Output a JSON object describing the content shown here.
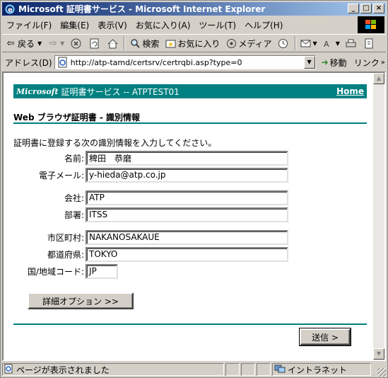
{
  "window": {
    "title": "Microsoft 証明書サービス - Microsoft Internet Explorer"
  },
  "menu": {
    "items": [
      "ファイル(F)",
      "編集(E)",
      "表示(V)",
      "お気に入り(A)",
      "ツール(T)",
      "ヘルプ(H)"
    ]
  },
  "toolbar": {
    "back_label": "戻る",
    "search_label": "検索",
    "favorites_label": "お気に入り",
    "media_label": "メディア"
  },
  "address": {
    "label": "アドレス(D)",
    "url": "http://atp-tamd/certsrv/certrqbi.asp?type=0",
    "go_label": "移動",
    "links_label": "リンク"
  },
  "page": {
    "brand": "Microsoft",
    "service_title": "証明書サービス  --  ATPTEST01",
    "home_link": "Home",
    "heading": "Web ブラウザ証明書 - 識別情報",
    "intro": "証明書に登録する次の識別情報を入力してください。",
    "fields": {
      "name": {
        "label": "名前:",
        "value": "稗田　恭磨"
      },
      "email": {
        "label": "電子メール:",
        "value": "y-hieda@atp.co.jp"
      },
      "company": {
        "label": "会社:",
        "value": "ATP"
      },
      "department": {
        "label": "部署:",
        "value": "ITSS"
      },
      "city": {
        "label": "市区町村:",
        "value": "NAKANOSAKAUE"
      },
      "state": {
        "label": "都道府県:",
        "value": "TOKYO"
      },
      "country": {
        "label": "国/地域コード:",
        "value": "JP"
      }
    },
    "advanced_button": "詳細オプション >>",
    "submit_button": "送信 >"
  },
  "status": {
    "text": "ページが表示されました",
    "zone": "イントラネット"
  }
}
